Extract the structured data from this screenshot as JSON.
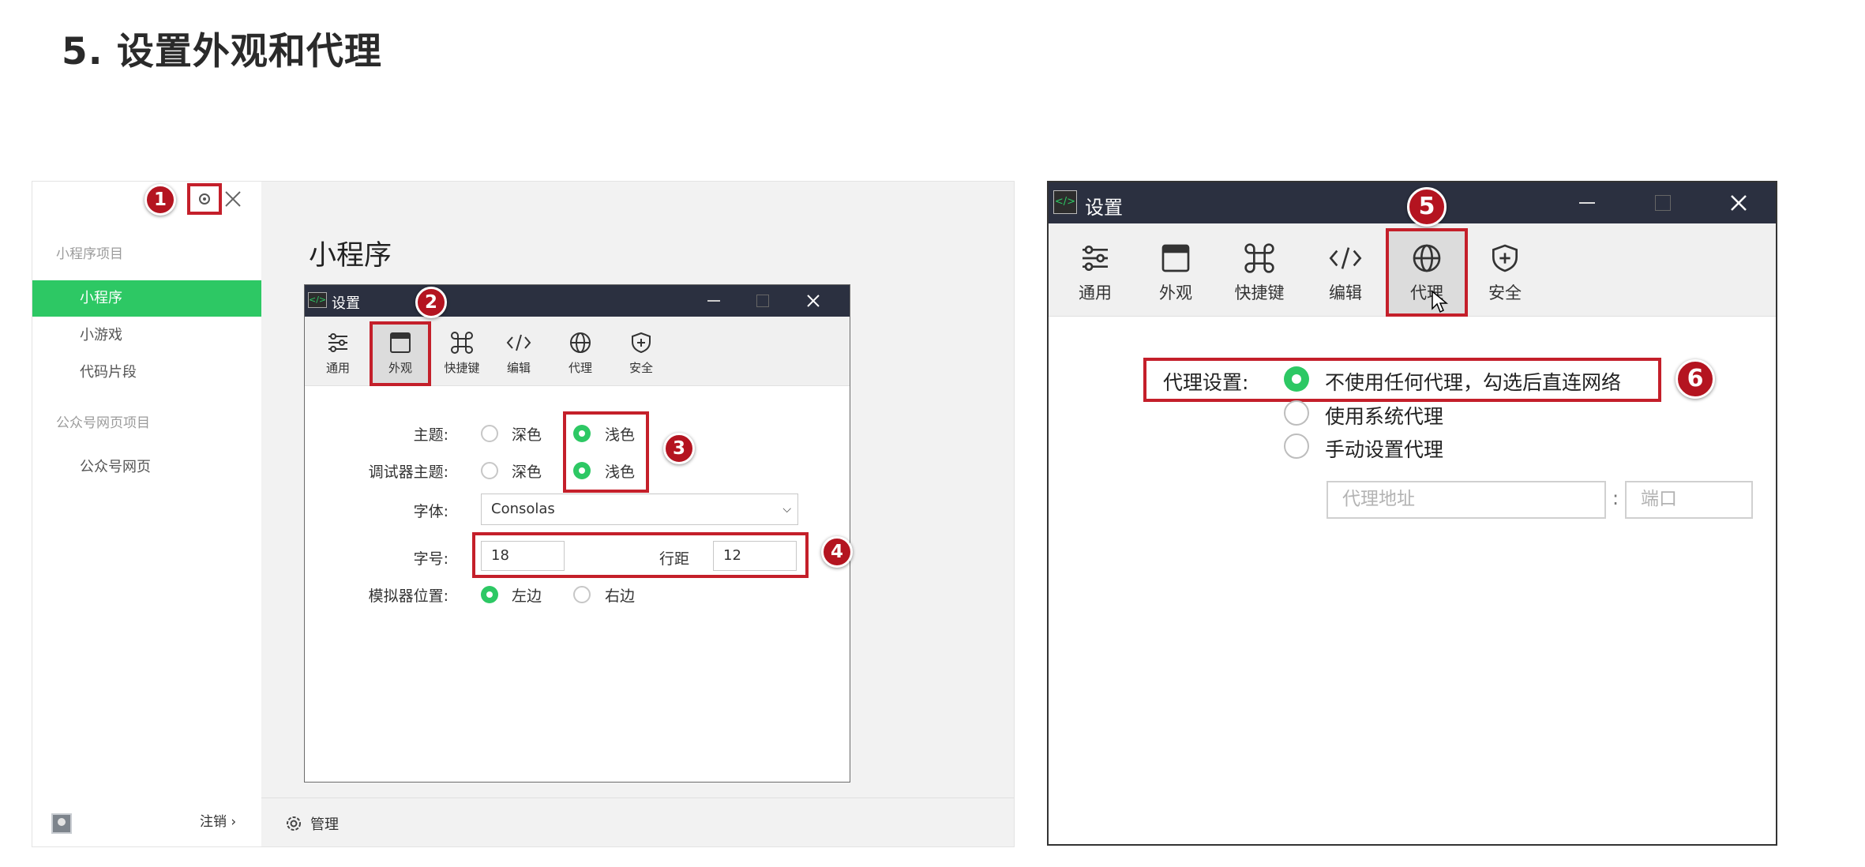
{
  "heading": "5. 设置外观和代理",
  "left_app": {
    "sidebar": {
      "section1": "小程序项目",
      "items": [
        "小程序",
        "小游戏",
        "代码片段"
      ],
      "section2": "公众号网页项目",
      "items2": [
        "公众号网页"
      ],
      "logout": "注销"
    },
    "main_title": "小程序",
    "footer_manage": "管理",
    "dialog": {
      "title": "设置",
      "tabs": [
        "通用",
        "外观",
        "快捷键",
        "编辑",
        "代理",
        "安全"
      ],
      "theme_label": "主题:",
      "debugger_theme_label": "调试器主题:",
      "font_label": "字体:",
      "font_size_label": "字号:",
      "line_height_label": "行距",
      "simulator_label": "模拟器位置:",
      "dark": "深色",
      "light": "浅色",
      "font_value": "Consolas",
      "font_size_value": "18",
      "line_height_value": "12",
      "left": "左边",
      "right": "右边"
    }
  },
  "right_dialog": {
    "title": "设置",
    "tabs": [
      "通用",
      "外观",
      "快捷键",
      "编辑",
      "代理",
      "安全"
    ],
    "proxy_label": "代理设置:",
    "options": [
      "不使用任何代理，勾选后直连网络",
      "使用系统代理",
      "手动设置代理"
    ],
    "address_placeholder": "代理地址",
    "port_placeholder": "端口",
    "colon": ":"
  },
  "badges": [
    "1",
    "2",
    "3",
    "4",
    "5",
    "6"
  ],
  "colors": {
    "accent_green": "#2dc864",
    "titlebar": "#2b3040",
    "marker_red": "#c41f2a"
  }
}
